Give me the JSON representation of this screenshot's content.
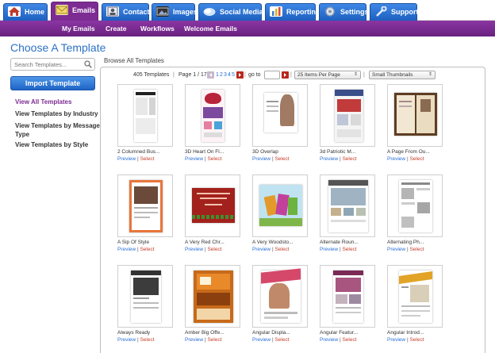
{
  "nav": {
    "tabs": [
      {
        "label": "Home",
        "active": false
      },
      {
        "label": "Emails",
        "active": true
      },
      {
        "label": "Contacts",
        "active": false
      },
      {
        "label": "Images",
        "active": false
      },
      {
        "label": "Social Media",
        "active": false
      },
      {
        "label": "Reporting",
        "active": false
      },
      {
        "label": "Settings",
        "active": false
      },
      {
        "label": "Support",
        "active": false
      }
    ],
    "subnav": [
      "My Emails",
      "Create",
      "Workflows",
      "Welcome Emails"
    ]
  },
  "page_title": "Choose A Template",
  "sidebar": {
    "search_placeholder": "Search Templates...",
    "import_button": "Import Template",
    "links": [
      {
        "label": "View All Templates",
        "active": true
      },
      {
        "label": "View Templates by Industry",
        "active": false
      },
      {
        "label": "View Templates by Message Type",
        "active": false
      },
      {
        "label": "View Templates by Style",
        "active": false
      }
    ]
  },
  "main": {
    "heading": "Browse All Templates",
    "pager": {
      "count": "405 Templates",
      "page_label": "Page 1 / 17",
      "page_numbers": [
        "1",
        "2",
        "3",
        "4",
        "5"
      ],
      "goto_label": "go to",
      "goto_value": "",
      "per_page": "25 Items Per Page",
      "view": "Small Thumbnails"
    },
    "preview_label": "Preview",
    "separator": "|",
    "select_label": "Select",
    "templates": [
      "2 Columned Bus...",
      "3D Heart On Fl...",
      "3D Overlap",
      "3d Patriotic M...",
      "A Page From Ou...",
      "A Sip Of Style",
      "A Very Red Chr...",
      "A Very Woodsto...",
      "Alternate Roun...",
      "Alternating Ph...",
      "Always Ready",
      "Amber Big Offe...",
      "Angular Displa...",
      "Angular Featur...",
      "Angular Introd..."
    ]
  },
  "colors": {
    "tab_blue": "#2a72d6",
    "brand_purple": "#7c2c93",
    "link_blue": "#2a6fd6",
    "select_red": "#c6402e",
    "title_blue": "#2c72c7"
  },
  "icons": [
    "home-icon",
    "emails-icon",
    "contacts-icon",
    "images-icon",
    "social-media-icon",
    "reporting-icon",
    "settings-icon",
    "support-icon",
    "search-icon",
    "prev-page-icon",
    "next-page-icon"
  ]
}
